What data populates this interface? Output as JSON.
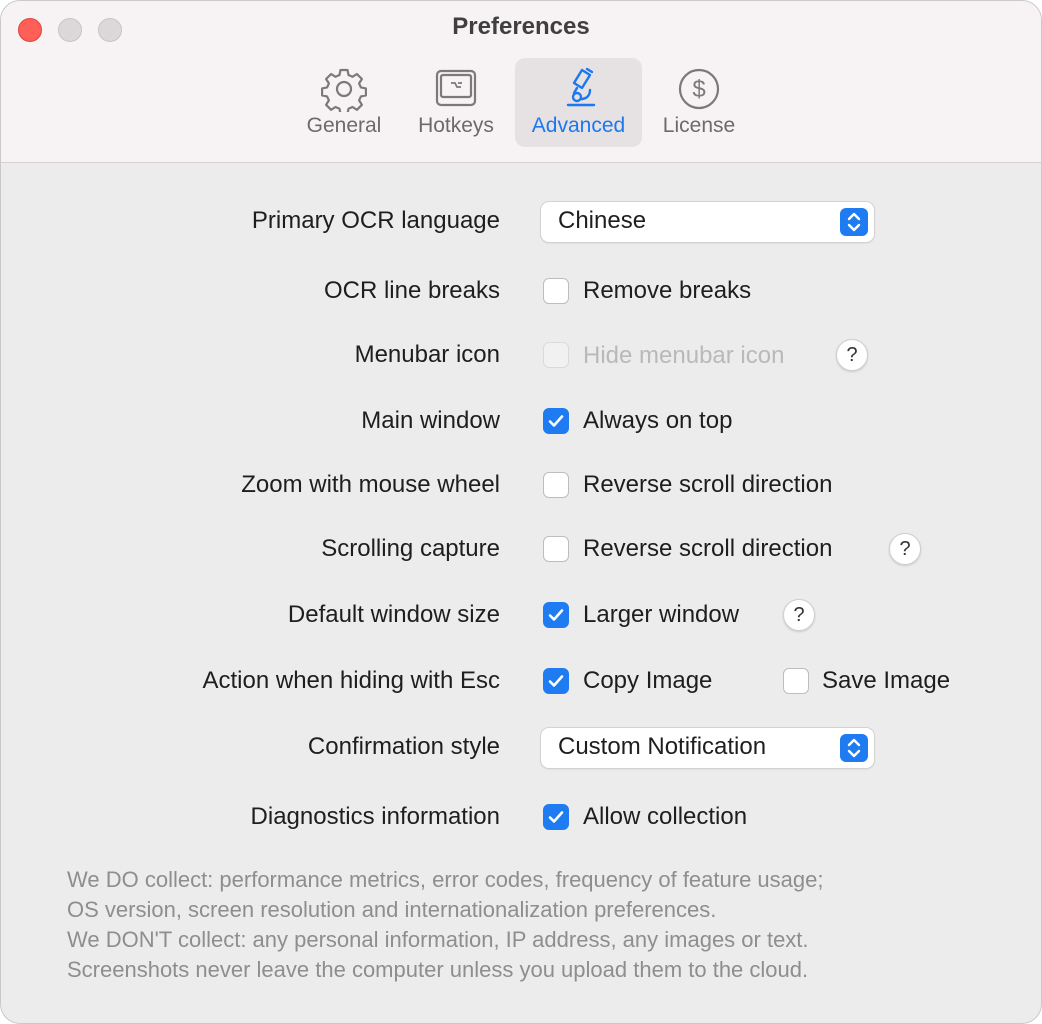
{
  "window": {
    "title": "Preferences"
  },
  "tabs": [
    {
      "label": "General",
      "icon": "gear-icon",
      "active": false
    },
    {
      "label": "Hotkeys",
      "icon": "keyboard-icon",
      "active": false
    },
    {
      "label": "Advanced",
      "icon": "microscope-icon",
      "active": true
    },
    {
      "label": "License",
      "icon": "dollar-circle-icon",
      "active": false
    }
  ],
  "settings": {
    "ocr_language": {
      "label": "Primary OCR language",
      "value": "Chinese"
    },
    "line_breaks": {
      "label": "OCR line breaks",
      "option": "Remove breaks",
      "checked": false
    },
    "menubar_icon": {
      "label": "Menubar icon",
      "option": "Hide menubar icon",
      "checked": false,
      "disabled": true,
      "help": "?"
    },
    "main_window": {
      "label": "Main window",
      "option": "Always on top",
      "checked": true
    },
    "zoom": {
      "label": "Zoom with mouse wheel",
      "option": "Reverse scroll direction",
      "checked": false
    },
    "scrolling_capture": {
      "label": "Scrolling capture",
      "option": "Reverse scroll direction",
      "checked": false,
      "help": "?"
    },
    "window_size": {
      "label": "Default window size",
      "option": "Larger window",
      "checked": true,
      "help": "?"
    },
    "esc_action": {
      "label": "Action when hiding with Esc",
      "option1": "Copy Image",
      "checked1": true,
      "option2": "Save Image",
      "checked2": false
    },
    "confirmation": {
      "label": "Confirmation style",
      "value": "Custom Notification"
    },
    "diagnostics": {
      "label": "Diagnostics information",
      "option": "Allow collection",
      "checked": true
    }
  },
  "info": [
    "We DO collect: performance metrics, error codes, frequency of feature usage;",
    "OS version, screen resolution and internationalization preferences.",
    "We DON'T collect: any personal information, IP address, any images or text.",
    "Screenshots never leave the computer unless you upload them to the cloud."
  ],
  "colors": {
    "accent": "#1e7bf2",
    "close": "#fe5f57",
    "titlebar": "#f7f2f3",
    "background": "#ececec"
  }
}
